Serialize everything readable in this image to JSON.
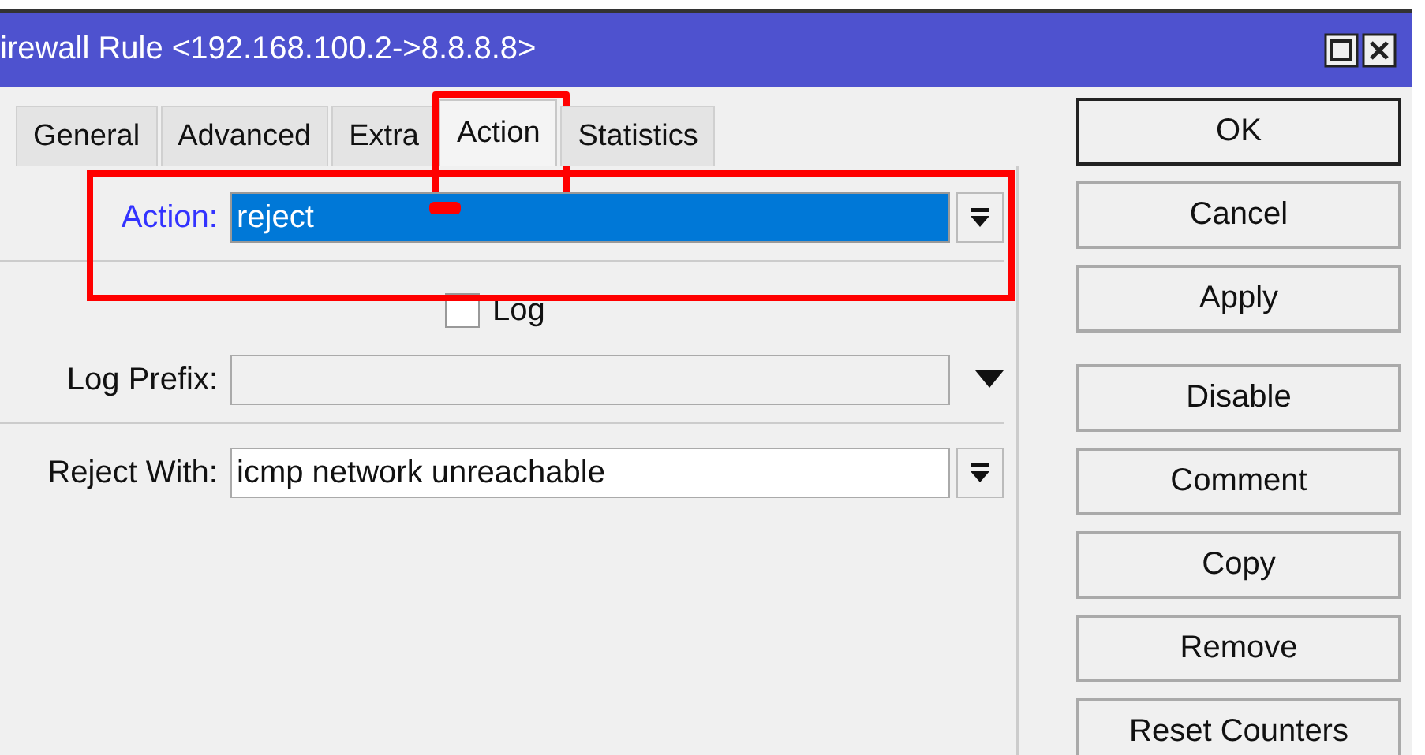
{
  "window": {
    "title": "irewall Rule <192.168.100.2->8.8.8.8>"
  },
  "tabs": [
    {
      "label": "General",
      "selected": false
    },
    {
      "label": "Advanced",
      "selected": false
    },
    {
      "label": "Extra",
      "selected": false
    },
    {
      "label": "Action",
      "selected": true
    },
    {
      "label": "Statistics",
      "selected": false
    }
  ],
  "sections": [
    [
      {
        "kind": "select",
        "label": "Action:",
        "value": "reject",
        "focused": true
      }
    ],
    [
      {
        "kind": "checkbox",
        "label": "Log",
        "checked": false
      },
      {
        "kind": "combo",
        "label": "Log Prefix:",
        "disabled": true
      }
    ],
    [
      {
        "kind": "select",
        "label": "Reject With:",
        "value": "icmp network unreachable",
        "focused": false
      }
    ]
  ],
  "button_groups": [
    [
      {
        "label": "OK",
        "default": true
      },
      {
        "label": "Cancel",
        "default": false
      },
      {
        "label": "Apply",
        "default": false
      }
    ],
    [
      {
        "label": "Disable",
        "default": false
      },
      {
        "label": "Comment",
        "default": false
      },
      {
        "label": "Copy",
        "default": false
      },
      {
        "label": "Remove",
        "default": false
      },
      {
        "label": "Reset Counters",
        "default": false
      }
    ]
  ]
}
